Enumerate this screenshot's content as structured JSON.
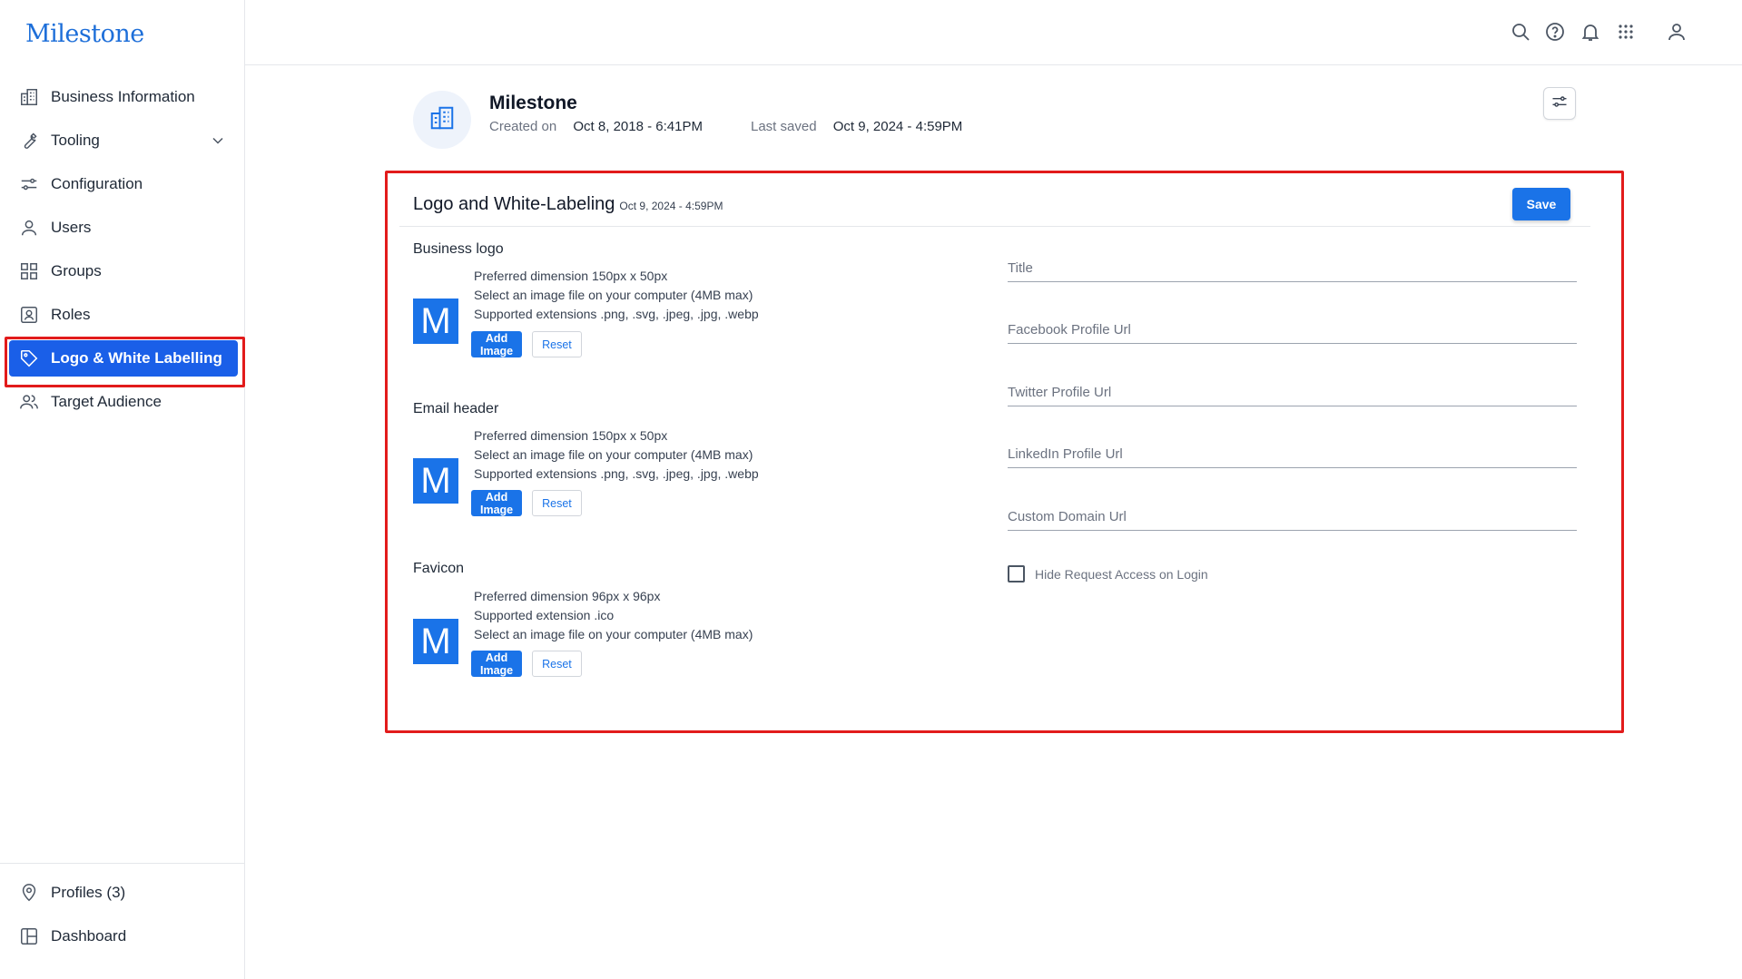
{
  "brand": {
    "logo_text": "Milestone",
    "accent": "#1a73e8",
    "active_nav": "#1a5fe8",
    "highlight": "#e21b1b"
  },
  "sidebar": {
    "items": [
      {
        "label": "Business Information",
        "icon": "building-icon"
      },
      {
        "label": "Tooling",
        "icon": "wrench-icon",
        "has_chevron": true
      },
      {
        "label": "Configuration",
        "icon": "sliders-icon"
      },
      {
        "label": "Users",
        "icon": "user-icon"
      },
      {
        "label": "Groups",
        "icon": "grid-icon"
      },
      {
        "label": "Roles",
        "icon": "id-badge-icon"
      },
      {
        "label": "Logo & White Labelling",
        "icon": "tag-icon",
        "active": true
      },
      {
        "label": "Target Audience",
        "icon": "users-icon"
      }
    ],
    "bottom": [
      {
        "label": "Profiles (3)",
        "icon": "location-pin-icon"
      },
      {
        "label": "Dashboard",
        "icon": "dashboard-icon"
      }
    ]
  },
  "topbar": {
    "icons": [
      "search-icon",
      "help-icon",
      "bell-icon",
      "apps-grid-icon",
      "account-icon"
    ]
  },
  "header": {
    "business_name": "Milestone",
    "created_label": "Created on",
    "created_value": "Oct 8, 2018 - 6:41PM",
    "saved_label": "Last saved",
    "saved_value": "Oct 9, 2024 - 4:59PM"
  },
  "card": {
    "title": "Logo and White-Labeling",
    "timestamp": "Oct 9, 2024 - 4:59PM",
    "save_label": "Save",
    "sections": [
      {
        "title": "Business logo",
        "thumb_letter": "M",
        "lines": [
          "Preferred dimension 150px x 50px",
          "Select an image file on your computer (4MB max)",
          "Supported extensions .png, .svg, .jpeg, .jpg, .webp"
        ],
        "add_label": "Add Image",
        "reset_label": "Reset"
      },
      {
        "title": "Email header",
        "thumb_letter": "M",
        "lines": [
          "Preferred dimension 150px x 50px",
          "Select an image file on your computer (4MB max)",
          "Supported extensions .png, .svg, .jpeg, .jpg, .webp"
        ],
        "add_label": "Add Image",
        "reset_label": "Reset"
      },
      {
        "title": "Favicon",
        "thumb_letter": "M",
        "lines": [
          "Preferred dimension 96px x 96px",
          "Supported extension .ico",
          "Select an image file on your computer (4MB max)"
        ],
        "add_label": "Add Image",
        "reset_label": "Reset"
      }
    ],
    "fields": [
      {
        "placeholder": "Title",
        "value": ""
      },
      {
        "placeholder": "Facebook Profile Url",
        "value": ""
      },
      {
        "placeholder": "Twitter Profile Url",
        "value": ""
      },
      {
        "placeholder": "LinkedIn Profile Url",
        "value": ""
      },
      {
        "placeholder": "Custom Domain Url",
        "value": ""
      }
    ],
    "checkbox_label": "Hide Request Access on Login",
    "checkbox_checked": false
  }
}
